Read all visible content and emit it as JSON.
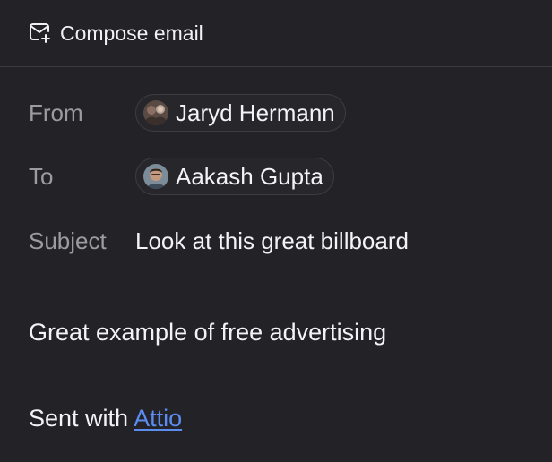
{
  "header": {
    "icon": "mail-plus-icon",
    "title": "Compose email"
  },
  "fields": {
    "from": {
      "label": "From",
      "recipient": {
        "name": "Jaryd Hermann",
        "avatar": "avatar-icon"
      }
    },
    "to": {
      "label": "To",
      "recipient": {
        "name": "Aakash Gupta",
        "avatar": "avatar-icon"
      }
    },
    "subject": {
      "label": "Subject",
      "value": "Look at this great billboard"
    }
  },
  "body": {
    "line1": "Great example of free advertising",
    "signature_prefix": "Sent with ",
    "signature_link": "Attio"
  },
  "colors": {
    "background": "#232327",
    "text": "#f3f3f5",
    "label": "#9b9ba1",
    "link": "#5b8cf0",
    "chip_border": "#3c3c43"
  }
}
